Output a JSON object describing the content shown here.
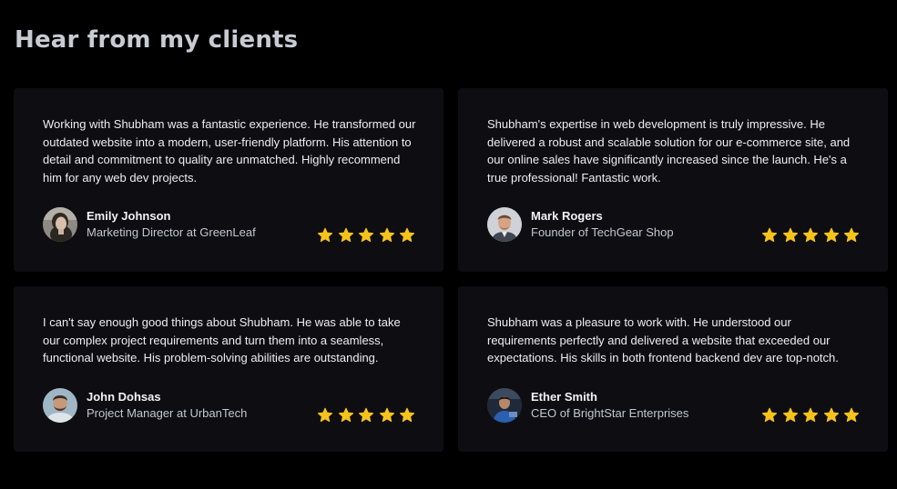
{
  "section": {
    "title": "Hear from my clients"
  },
  "colors": {
    "background": "#000000",
    "card": "#0e0e12",
    "title": "#c9cbd3",
    "star": "#f6c21c"
  },
  "testimonials": [
    {
      "quote": "Working with Shubham was a fantastic experience. He transformed our outdated website into a modern, user-friendly platform. His attention to detail and commitment to quality are unmatched. Highly recommend him for any web dev projects.",
      "name": "Emily Johnson",
      "role": "Marketing Director at GreenLeaf",
      "rating": 5,
      "avatar_icon": "avatar-photo-woman"
    },
    {
      "quote": "Shubham's expertise in web development is truly impressive. He delivered a robust and scalable solution for our e-commerce site, and our online sales have significantly increased since the launch. He's a true professional! Fantastic work.",
      "name": "Mark Rogers",
      "role": "Founder of TechGear Shop",
      "rating": 5,
      "avatar_icon": "avatar-photo-man"
    },
    {
      "quote": "I can't say enough good things about Shubham. He was able to take our complex project requirements and turn them into a seamless, functional website. His problem-solving abilities are outstanding.",
      "name": "John Dohsas",
      "role": "Project Manager at UrbanTech",
      "rating": 5,
      "avatar_icon": "avatar-photo-man"
    },
    {
      "quote": "Shubham was a pleasure to work with. He understood our requirements perfectly and delivered a website that exceeded our expectations. His skills in both frontend backend dev are top-notch.",
      "name": "Ether Smith",
      "role": "CEO of BrightStar Enterprises",
      "rating": 5,
      "avatar_icon": "avatar-photo-man"
    }
  ]
}
